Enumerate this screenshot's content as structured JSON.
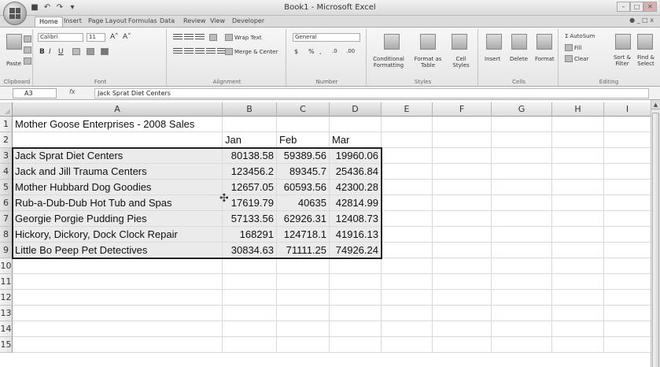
{
  "app": {
    "title": "Book1 - Microsoft Excel",
    "window_controls": [
      "–",
      "□",
      "✕"
    ]
  },
  "quick_access": {
    "save_glyph": "■",
    "undo_glyph": "↶",
    "redo_glyph": "↷",
    "more_glyph": "▾"
  },
  "ribbon": {
    "tabs": [
      "Home",
      "Insert",
      "Page Layout",
      "Formulas",
      "Data",
      "Review",
      "View",
      "Developer"
    ],
    "active_tab": "Home",
    "help_glyph": "● _ □ x",
    "groups": {
      "clipboard": {
        "label": "Clipboard",
        "paste": "Paste"
      },
      "font": {
        "label": "Font",
        "name": "Calibri",
        "size": "11",
        "grow": "A˄",
        "shrink": "A˅",
        "bold": "B",
        "italic": "I",
        "underline": "U"
      },
      "alignment": {
        "label": "Alignment",
        "wrap": "Wrap Text",
        "merge": "Merge & Center"
      },
      "number": {
        "label": "Number",
        "format": "General",
        "currency": "$",
        "percent": "%",
        "comma": ",",
        "inc": ".0",
        "dec": ".00"
      },
      "styles": {
        "label": "Styles",
        "conditional": "Conditional Formatting",
        "format_table": "Format as Table",
        "cell_styles": "Cell Styles"
      },
      "cells": {
        "label": "Cells",
        "insert": "Insert",
        "delete": "Delete",
        "format": "Format"
      },
      "editing": {
        "label": "Editing",
        "autosum": "AutoSum",
        "fill": "Fill",
        "clear": "Clear",
        "sort": "Sort & Filter",
        "find": "Find & Select"
      }
    }
  },
  "formula_bar": {
    "name_box": "A3",
    "fx": "fx",
    "formula": "Jack Sprat Diet Centers"
  },
  "sheet": {
    "columns": [
      "A",
      "B",
      "C",
      "D",
      "E",
      "F",
      "G",
      "H",
      "I"
    ],
    "rows": [
      "1",
      "2",
      "3",
      "4",
      "5",
      "6",
      "7",
      "8",
      "9",
      "10",
      "11",
      "12",
      "13",
      "14",
      "15"
    ],
    "title": "Mother Goose Enterprises - 2008 Sales",
    "headers": [
      "Jan",
      "Feb",
      "Mar"
    ],
    "data": [
      {
        "name": "Jack Sprat Diet Centers",
        "jan": "80138.58",
        "feb": "59389.56",
        "mar": "19960.06"
      },
      {
        "name": "Jack and Jill Trauma Centers",
        "jan": "123456.2",
        "feb": "89345.7",
        "mar": "25436.84"
      },
      {
        "name": "Mother Hubbard Dog Goodies",
        "jan": "12657.05",
        "feb": "60593.56",
        "mar": "42300.28"
      },
      {
        "name": "Rub-a-Dub-Dub Hot Tub and Spas",
        "jan": "17619.79",
        "feb": "40635",
        "mar": "42814.99"
      },
      {
        "name": "Georgie Porgie Pudding Pies",
        "jan": "57133.56",
        "feb": "62926.31",
        "mar": "12408.73"
      },
      {
        "name": "Hickory, Dickory, Dock Clock Repair",
        "jan": "168291",
        "feb": "124718.1",
        "mar": "41916.13"
      },
      {
        "name": "Little Bo Peep Pet Detectives",
        "jan": "30834.63",
        "feb": "71111.25",
        "mar": "74926.24"
      }
    ]
  }
}
